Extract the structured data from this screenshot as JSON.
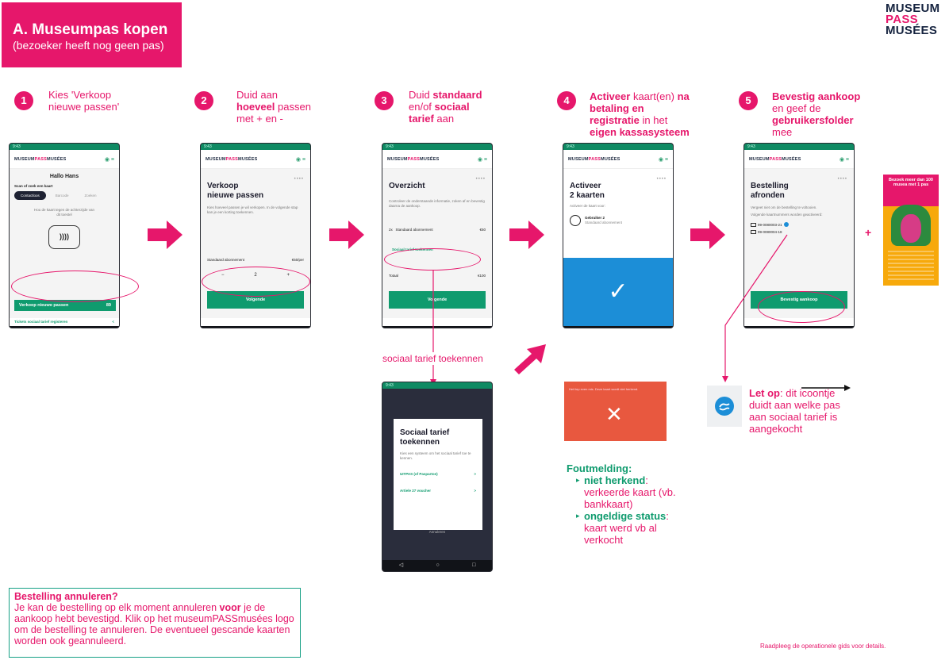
{
  "header": {
    "title": "A. Museumpas kopen",
    "subtitle": "(bezoeker heeft nog geen pas)"
  },
  "logo": {
    "line1": "MUSEUM",
    "line2": "PASS",
    "line3": "MUSÉES"
  },
  "steps": [
    {
      "num": "1",
      "parts": [
        "Kies 'Verkoop",
        "nieuwe passen'"
      ]
    },
    {
      "num": "2",
      "prefix": "Duid aan",
      "bold": "hoeveel",
      "rest": "passen",
      "line3": "met + en -"
    },
    {
      "num": "3",
      "prefix": "Duid",
      "bold1": "standaard",
      "mid": "en/of",
      "bold2": "sociaal",
      "bold3": "tarief",
      "rest": "aan"
    },
    {
      "num": "4",
      "bold1": "Activeer",
      "mid1": "kaart(en)",
      "bold2": "na",
      "bold3": "betaling en",
      "bold4": "registratie",
      "mid2": "in het",
      "bold5": "eigen kassasysteem"
    },
    {
      "num": "5",
      "bold1": "Bevestig aankoop",
      "mid1": "en geef de",
      "bold2": "gebruikersfolder",
      "rest": "mee"
    }
  ],
  "phone_common": {
    "statusbar": "9:43",
    "brand_a": "MUSEUM",
    "brand_b": "PASS",
    "brand_c": "MUSÉES",
    "icons": "◉  ≡",
    "nav": [
      "◁",
      "○",
      "□"
    ],
    "dots": "••••"
  },
  "phone1": {
    "greeting": "Hallo Hans",
    "scan_label": "Scan of zoek een kaart",
    "tabs": [
      "Contactloos",
      "Barcode",
      "Zoeken"
    ],
    "hint": "Hou de kaart tegen de achterzijde van dit toestel",
    "contactless_glyph": "))))",
    "sell_button": "Verkoop nieuwe passen",
    "sell_count": "89",
    "link": "Tickets sociaal tarief registeren",
    "link_arrow": "<"
  },
  "phone2": {
    "title_l1": "Verkoop",
    "title_l2": "nieuwe passen",
    "desc": "Kies hoeveel passen je wil verkopen. In de volgende stap kan je een korting toekennen.",
    "product": "Standaard abonnement",
    "price": "€50/per",
    "minus": "−",
    "qty": "2",
    "plus": "+",
    "next": "Volgende"
  },
  "phone3": {
    "title": "Overzicht",
    "desc": "Controleer de onderstaande informatie, zoken af en bevestig daarna de aankoop.",
    "row_qty": "2x",
    "row_label": "Standaard abonnement",
    "row_price": "€50",
    "social_link": "Sociaal tarief toekennen",
    "total_label": "Totaal",
    "total_value": "€100",
    "next": "Volgende"
  },
  "phone3b": {
    "title_l1": "Sociaal tarief",
    "title_l2": "toekennen",
    "desc": "Kies een systeem om het sociaal tarief toe te kennen.",
    "opt1": "UITPAS (of Paspartoe)",
    "opt2": "Artiele 27 voucher",
    "chev": ">",
    "cancel": "Annuleren"
  },
  "phone4": {
    "title_l1": "Activeer",
    "title_l2": "2 kaarten",
    "sub": "Activeer de kaart voor:",
    "user": "Gebruiker 2",
    "user_sub": "Standaard abonnement",
    "check": "✓"
  },
  "phone5": {
    "title_l1": "Bestelling",
    "title_l2": "afronden",
    "desc1": "Vergeet niet om de bestelling te voltooien.",
    "desc2": "Volgende kaartnummers worden geactiveerd:",
    "card1": "99-0080003-21",
    "card2": "99-0080004-18",
    "confirm": "Bevestig aankoop"
  },
  "social_label": "sociaal tarief toekennen",
  "error": {
    "msg": "Het liep even mis. Deze kaart wordt niet herkend.",
    "x": "✕"
  },
  "foutmelding": {
    "head": "Foutmelding:",
    "items": [
      {
        "bold": "niet herkend",
        "rest": ": verkeerde kaart (vb. bankkaart)"
      },
      {
        "bold": "ongeldige status",
        "rest": ": kaart werd vb al verkocht"
      }
    ]
  },
  "letop": {
    "bold": "Let op",
    "rest": ": dit icoontje duidt aan welke pas aan sociaal tarief is aangekocht"
  },
  "folder": {
    "headline": "Bezoek meer dan 100 musea met 1 pas",
    "plus": "+"
  },
  "cancel": {
    "head": "Bestelling annuleren?",
    "pre": "Je kan de bestelling op elk moment annuleren ",
    "bold": "voor",
    "post": " je de aankoop hebt bevestigd. Klik op het museumPASSmusées logo om de bestelling te annuleren. De eventueel gescande kaarten worden ook geannuleerd."
  },
  "footer": "Raadpleeg de operationele gids voor details."
}
